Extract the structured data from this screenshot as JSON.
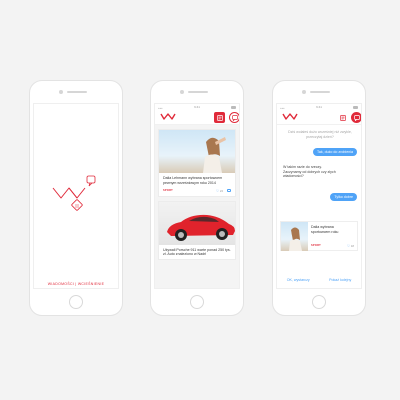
{
  "colors": {
    "accent": "#e02a3a",
    "blue": "#4fa3f7",
    "background": "#f3f3f3"
  },
  "icons": [
    "logo-mark",
    "news-icon",
    "chat-icon",
    "heart-icon",
    "comment-icon"
  ],
  "splash": {
    "tagline": "WIADOMOŚCI | WCIEŚNIENIE"
  },
  "feed": {
    "status_time": "9:41",
    "cards": [
      {
        "title": "Dalia Lehmann wybrana sportowcem pewnym wrześniowym roku 2014",
        "tag": "SPORT",
        "likes": "24"
      },
      {
        "title": "Używali Porsche 911 warte ponad 250 tys. zł. Auto znaleziono w Nadrl",
        "tag": "",
        "likes": ""
      }
    ]
  },
  "chat": {
    "status_time": "9:41",
    "bot_msg_1": "Dziś wolałeś dużo wcześniej niż zwykle, przeczytaj dzień?",
    "user_reply_1": "Tak, dużo do zrobienia",
    "bot_msg_2": "W takim razie do rzeczy. Zaczynamy od dobrych czy złych wiadomości?",
    "user_reply_2": "Tylko dobre",
    "card": {
      "title": "Dalia wybrana sportowcem roku",
      "tag": "SPORT",
      "likes": "18"
    },
    "action_ok": "OK, wystarczy",
    "action_next": "Pokaż kolejny"
  }
}
